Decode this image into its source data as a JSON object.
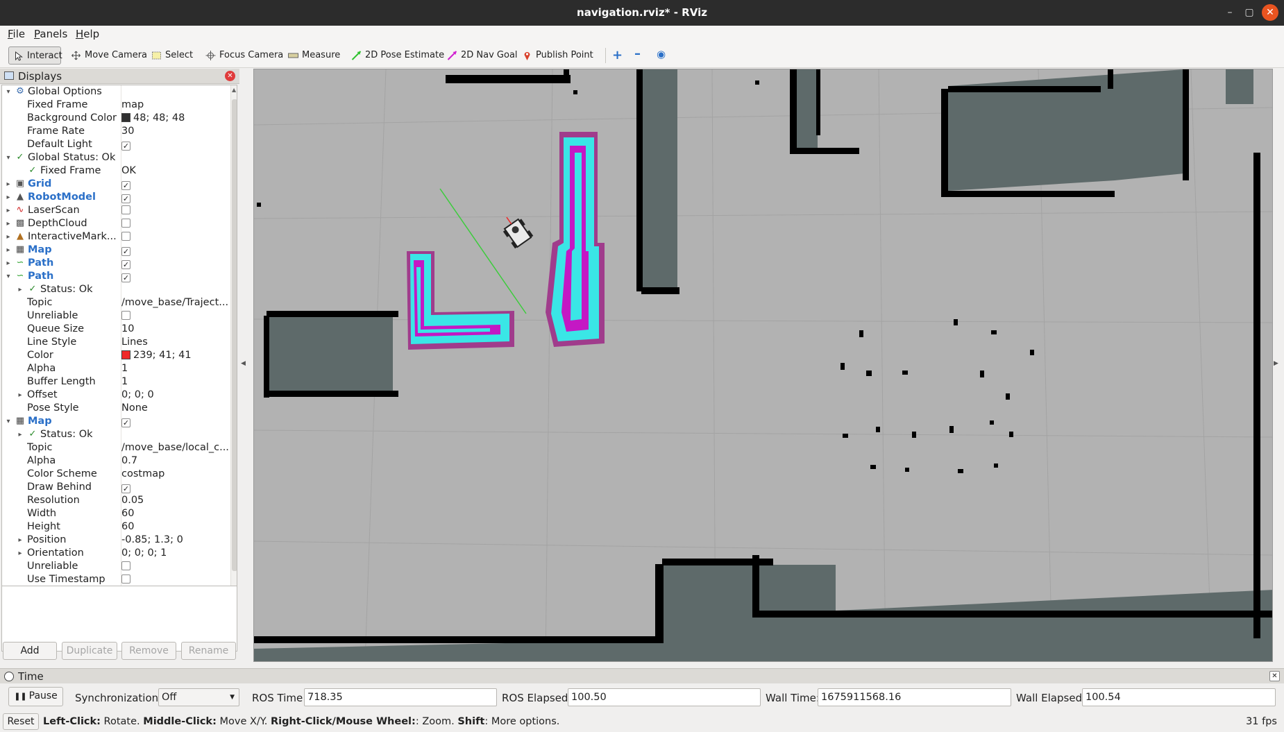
{
  "window": {
    "title": "navigation.rviz* - RViz"
  },
  "menu": [
    "File",
    "Panels",
    "Help"
  ],
  "toolbar": {
    "tools": [
      {
        "label": "Interact",
        "icon": "interact-icon"
      },
      {
        "label": "Move Camera",
        "icon": "move-camera-icon"
      },
      {
        "label": "Select",
        "icon": "select-icon"
      },
      {
        "label": "Focus Camera",
        "icon": "focus-camera-icon"
      },
      {
        "label": "Measure",
        "icon": "measure-icon"
      },
      {
        "label": "2D Pose Estimate",
        "icon": "pose-estimate-icon"
      },
      {
        "label": "2D Nav Goal",
        "icon": "nav-goal-icon"
      },
      {
        "label": "Publish Point",
        "icon": "publish-point-icon"
      }
    ]
  },
  "displays": {
    "title": "Displays",
    "rows": [
      {
        "label": "Global Options",
        "value": "",
        "indent": 0,
        "arrow": "down",
        "icon": "gear-icon"
      },
      {
        "label": "Fixed Frame",
        "value": "map",
        "indent": 1
      },
      {
        "label": "Background Color",
        "value": "48; 48; 48",
        "indent": 1,
        "swatch": "#303030"
      },
      {
        "label": "Frame Rate",
        "value": "30",
        "indent": 1
      },
      {
        "label": "Default Light",
        "value": "",
        "indent": 1,
        "check": true
      },
      {
        "label": "Global Status: Ok",
        "value": "",
        "indent": 0,
        "arrow": "down",
        "icon": "check-icon"
      },
      {
        "label": "Fixed Frame",
        "value": "OK",
        "indent": 1,
        "icon": "check-icon"
      },
      {
        "label": "Grid",
        "value": "",
        "indent": 0,
        "arrow": "right",
        "icon": "grid-icon",
        "blue": true,
        "check": true
      },
      {
        "label": "RobotModel",
        "value": "",
        "indent": 0,
        "arrow": "right",
        "icon": "robot-icon",
        "blue": true,
        "check": true
      },
      {
        "label": "LaserScan",
        "value": "",
        "indent": 0,
        "arrow": "right",
        "icon": "laserscan-icon",
        "check": false
      },
      {
        "label": "DepthCloud",
        "value": "",
        "indent": 0,
        "arrow": "right",
        "icon": "depthcloud-icon",
        "check": false
      },
      {
        "label": "InteractiveMark...",
        "value": "",
        "indent": 0,
        "arrow": "right",
        "icon": "marker-icon",
        "check": false
      },
      {
        "label": "Map",
        "value": "",
        "indent": 0,
        "arrow": "right",
        "icon": "map-icon",
        "blue": true,
        "check": true
      },
      {
        "label": "Path",
        "value": "",
        "indent": 0,
        "arrow": "right",
        "icon": "path-icon",
        "blue": true,
        "check": true
      },
      {
        "label": "Path",
        "value": "",
        "indent": 0,
        "arrow": "down",
        "icon": "path-icon",
        "blue": true,
        "check": true
      },
      {
        "label": "Status: Ok",
        "value": "",
        "indent": 1,
        "arrow": "right",
        "icon": "check-icon"
      },
      {
        "label": "Topic",
        "value": "/move_base/Traject...",
        "indent": 1
      },
      {
        "label": "Unreliable",
        "value": "",
        "indent": 1,
        "check": false
      },
      {
        "label": "Queue Size",
        "value": "10",
        "indent": 1
      },
      {
        "label": "Line Style",
        "value": "Lines",
        "indent": 1
      },
      {
        "label": "Color",
        "value": "239; 41; 41",
        "indent": 1,
        "swatch": "#ef2929"
      },
      {
        "label": "Alpha",
        "value": "1",
        "indent": 1
      },
      {
        "label": "Buffer Length",
        "value": "1",
        "indent": 1
      },
      {
        "label": "Offset",
        "value": "0; 0; 0",
        "indent": 1,
        "arrow": "right"
      },
      {
        "label": "Pose Style",
        "value": "None",
        "indent": 1
      },
      {
        "label": "Map",
        "value": "",
        "indent": 0,
        "arrow": "down",
        "icon": "map-icon",
        "blue": true,
        "check": true
      },
      {
        "label": "Status: Ok",
        "value": "",
        "indent": 1,
        "arrow": "right",
        "icon": "check-icon"
      },
      {
        "label": "Topic",
        "value": "/move_base/local_c...",
        "indent": 1
      },
      {
        "label": "Alpha",
        "value": "0.7",
        "indent": 1
      },
      {
        "label": "Color Scheme",
        "value": "costmap",
        "indent": 1
      },
      {
        "label": "Draw Behind",
        "value": "",
        "indent": 1,
        "check": true
      },
      {
        "label": "Resolution",
        "value": "0.05",
        "indent": 1
      },
      {
        "label": "Width",
        "value": "60",
        "indent": 1
      },
      {
        "label": "Height",
        "value": "60",
        "indent": 1
      },
      {
        "label": "Position",
        "value": "-0.85; 1.3; 0",
        "indent": 1,
        "arrow": "right"
      },
      {
        "label": "Orientation",
        "value": "0; 0; 0; 1",
        "indent": 1,
        "arrow": "right"
      },
      {
        "label": "Unreliable",
        "value": "",
        "indent": 1,
        "check": false
      },
      {
        "label": "Use Timestamp",
        "value": "",
        "indent": 1,
        "check": false
      }
    ],
    "buttons": {
      "add": "Add",
      "duplicate": "Duplicate",
      "remove": "Remove",
      "rename": "Rename"
    }
  },
  "time": {
    "title": "Time",
    "pause_label": "Pause",
    "sync_label": "Synchronization:",
    "sync_value": "Off",
    "ros_time_label": "ROS Time:",
    "ros_time": "718.35",
    "ros_elapsed_label": "ROS Elapsed:",
    "ros_elapsed": "100.50",
    "wall_time_label": "Wall Time:",
    "wall_time": "1675911568.16",
    "wall_elapsed_label": "Wall Elapsed:",
    "wall_elapsed": "100.54"
  },
  "status": {
    "reset_label": "Reset",
    "hint_parts": [
      {
        "bold": "Left-Click:",
        "text": " Rotate. "
      },
      {
        "bold": "Middle-Click:",
        "text": " Move X/Y. "
      },
      {
        "bold": "Right-Click/Mouse Wheel:",
        "text": ": Zoom. "
      },
      {
        "bold": "Shift",
        "text": ": More options."
      }
    ],
    "fps": "31 fps"
  },
  "colors": {
    "map_free": "#b2b2b2",
    "map_unknown": "#5e6a6a",
    "map_wall": "#000000",
    "costmap_cyan": "#3ae6e6",
    "costmap_magenta": "#c418c4",
    "costmap_purple": "#a03c8c",
    "path_red": "#ef2929",
    "plan_green": "#3ccc3c",
    "grid_line": "#a0a0a0"
  }
}
